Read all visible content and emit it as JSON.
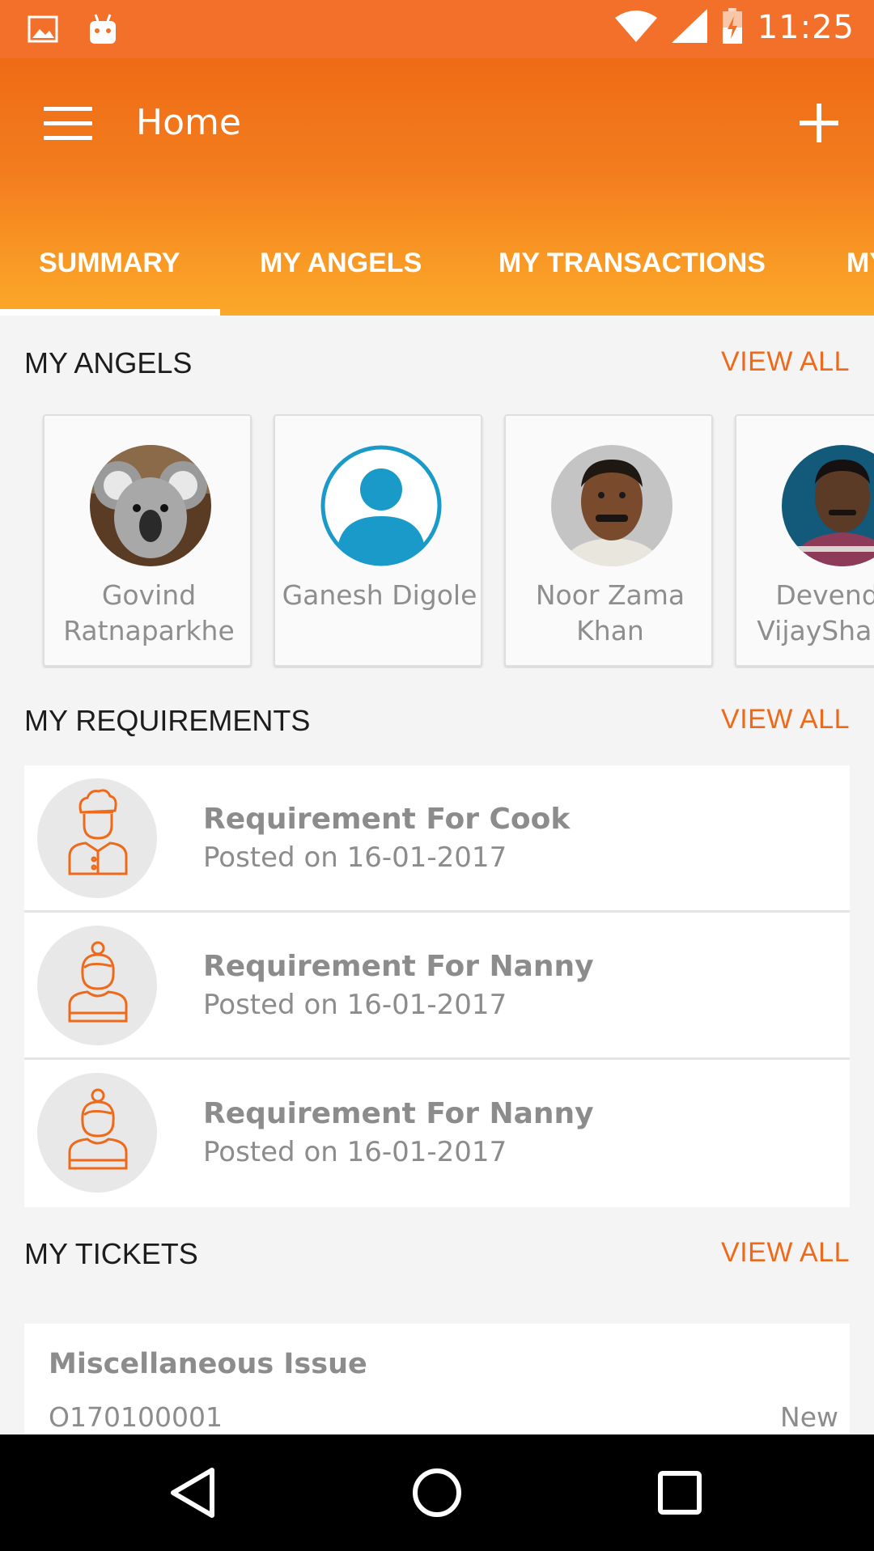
{
  "status_bar": {
    "time": "11:25",
    "icons": [
      "image-icon",
      "android-icon",
      "wifi-icon",
      "signal-icon",
      "battery-charging-icon"
    ]
  },
  "app_bar": {
    "title": "Home",
    "menu_icon": "hamburger-menu-icon",
    "add_icon": "plus-icon"
  },
  "tabs": [
    {
      "label": "SUMMARY",
      "active": true
    },
    {
      "label": "MY ANGELS",
      "active": false
    },
    {
      "label": "MY TRANSACTIONS",
      "active": false
    },
    {
      "label": "MY",
      "active": false
    }
  ],
  "angels": {
    "title": "MY ANGELS",
    "view_all": "VIEW ALL",
    "items": [
      {
        "name": "Govind Ratnaparkhe",
        "avatar": "koala-photo"
      },
      {
        "name": "Ganesh Digole",
        "avatar": "default-user-icon"
      },
      {
        "name": "Noor Zama Khan",
        "avatar": "man-photo"
      },
      {
        "name": "Devendra VijaySharma",
        "avatar": "man-photo"
      }
    ]
  },
  "requirements": {
    "title": "MY REQUIREMENTS",
    "view_all": "VIEW ALL",
    "items": [
      {
        "title": "Requirement For Cook",
        "posted": "Posted on 16-01-2017",
        "icon": "chef-icon"
      },
      {
        "title": "Requirement For Nanny",
        "posted": "Posted on 16-01-2017",
        "icon": "nanny-icon"
      },
      {
        "title": "Requirement For Nanny",
        "posted": "Posted on 16-01-2017",
        "icon": "nanny-icon"
      }
    ]
  },
  "tickets": {
    "title": "MY TICKETS",
    "view_all": "VIEW ALL",
    "items": [
      {
        "title": "Miscellaneous Issue",
        "id": "O170100001",
        "status": "New"
      }
    ]
  },
  "colors": {
    "accent": "#ee6a1a",
    "status_bar": "#f3702a",
    "text_muted": "#8c8c8c"
  }
}
